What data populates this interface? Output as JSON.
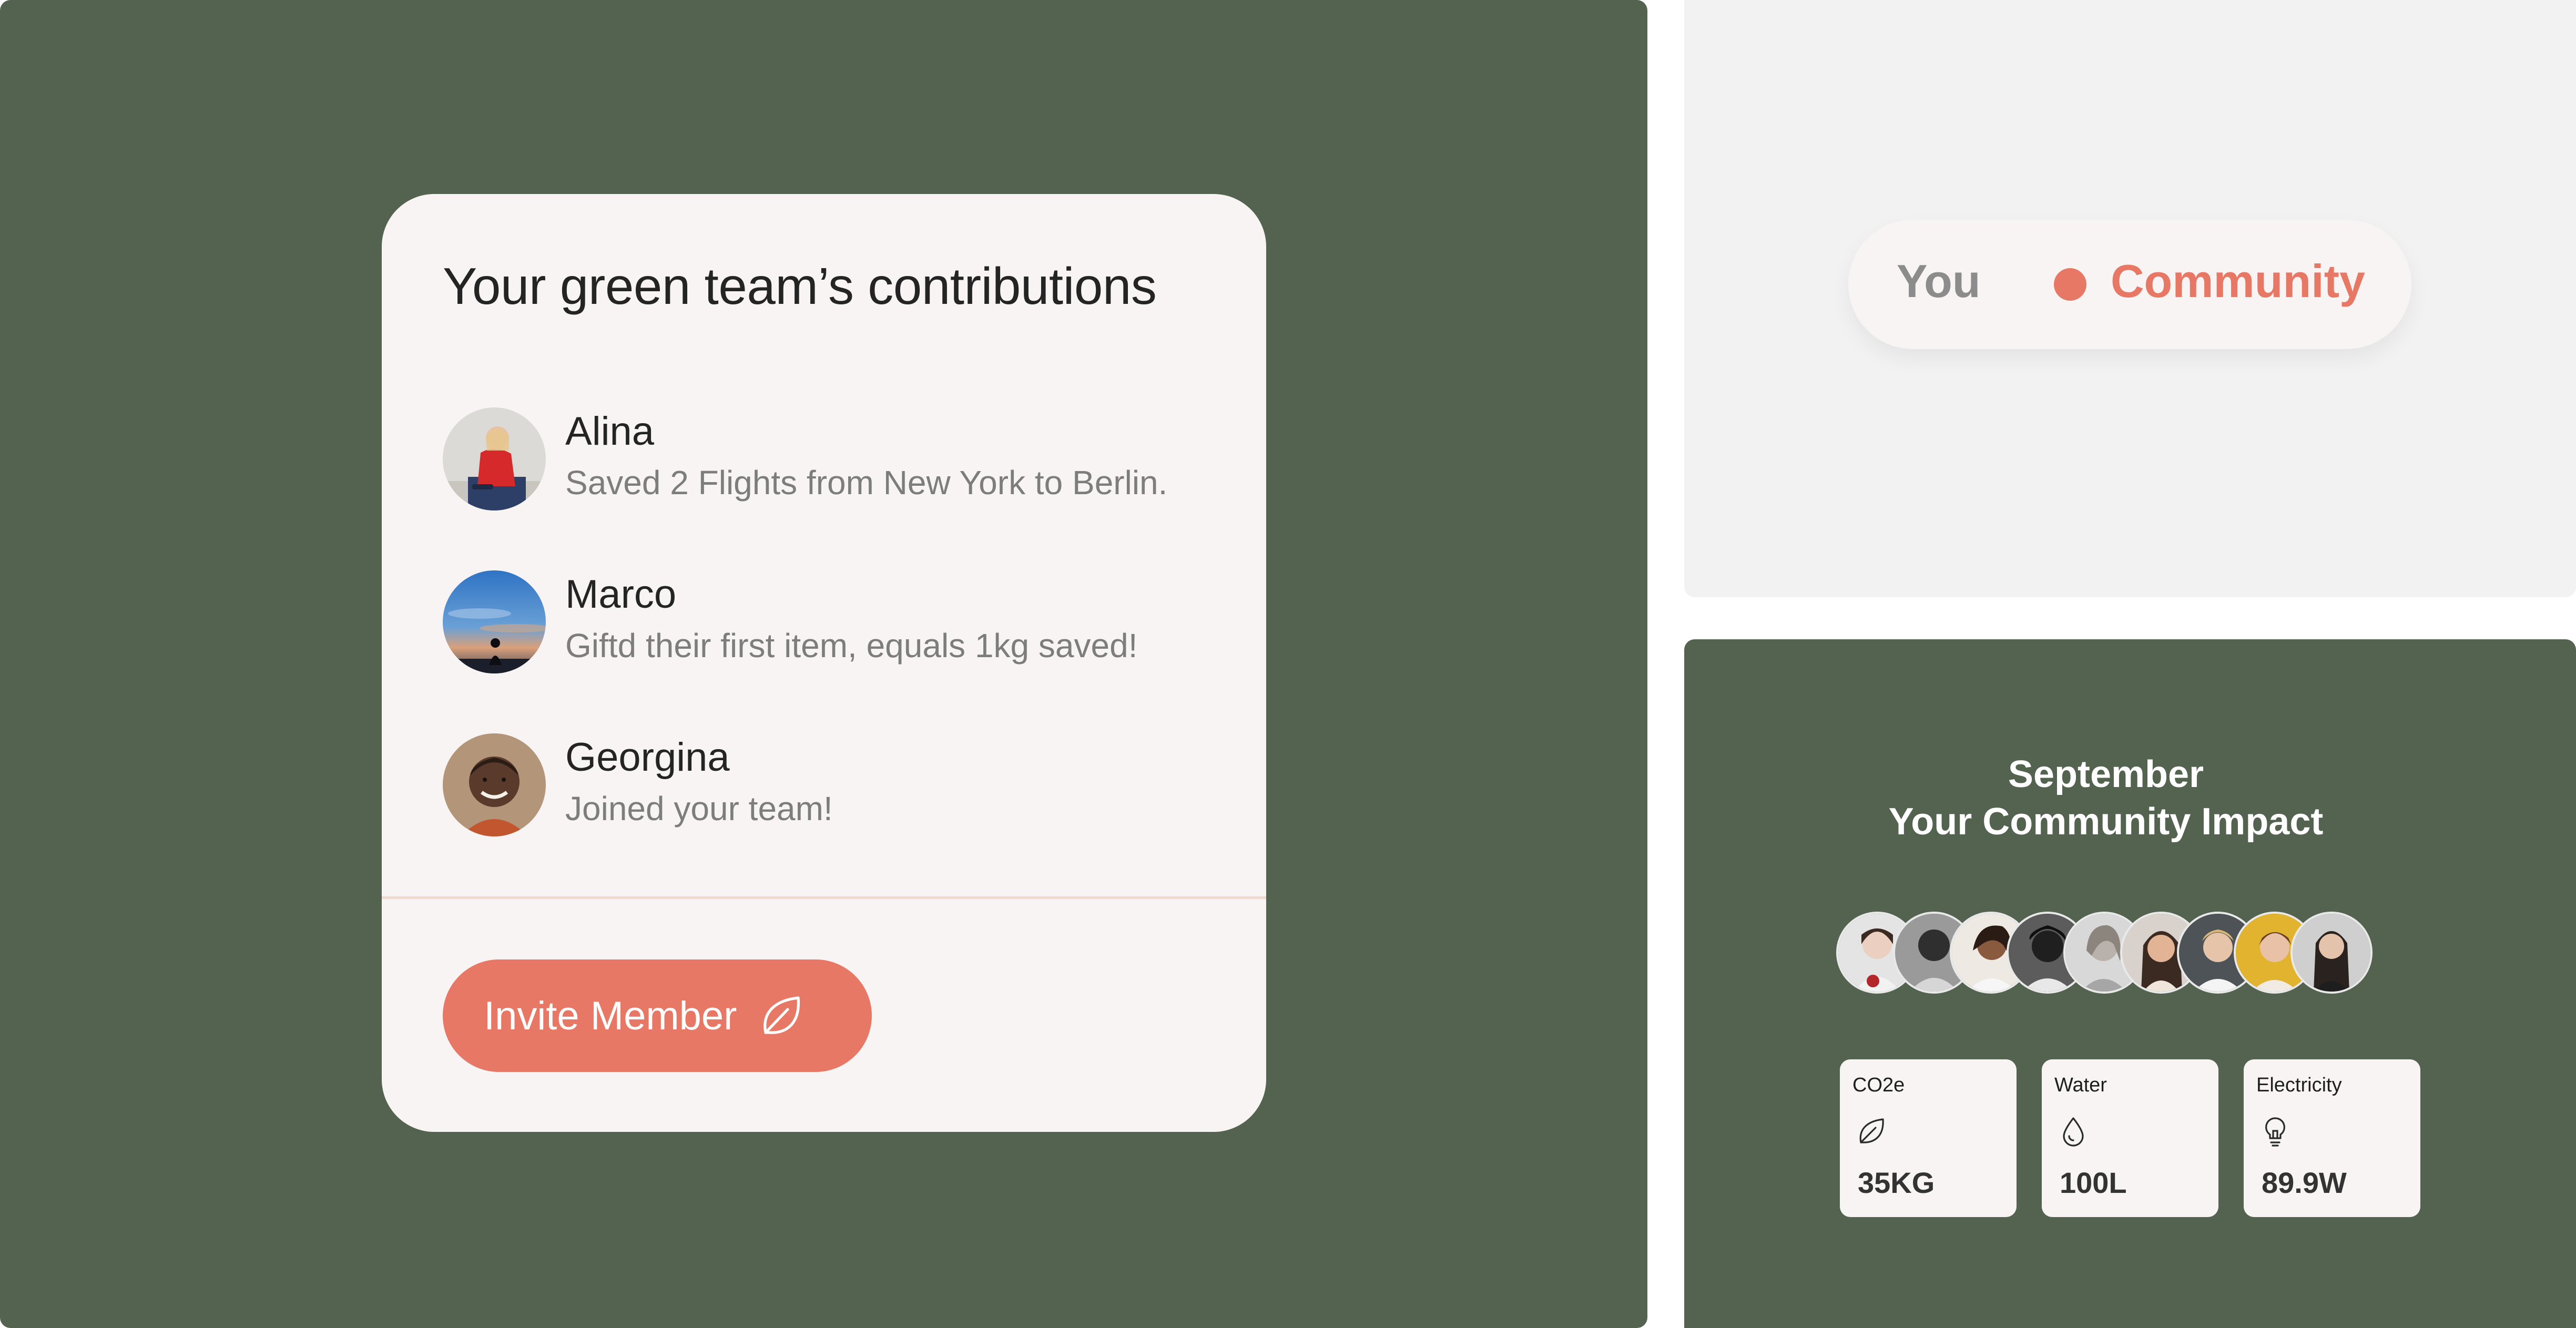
{
  "contributions": {
    "title": "Your green team’s contributions",
    "members": [
      {
        "name": "Alina",
        "description": "Saved 2 Flights from New York to Berlin."
      },
      {
        "name": "Marco",
        "description": "Giftd their first item, equals 1kg saved!"
      },
      {
        "name": "Georgina",
        "description": "Joined your team!"
      }
    ],
    "invite_button": {
      "label": "Invite Member",
      "icon": "leaf-icon"
    }
  },
  "toggle": {
    "options": [
      "You",
      "Community"
    ],
    "selected": "Community"
  },
  "impact": {
    "month": "September",
    "title": "Your Community Impact",
    "avatar_count": 9,
    "stats": [
      {
        "label": "CO2e",
        "icon": "leaf-icon",
        "value": "35KG"
      },
      {
        "label": "Water",
        "icon": "water-drop-icon",
        "value": "100L"
      },
      {
        "label": "Electricity",
        "icon": "lightbulb-icon",
        "value": "89.9W"
      }
    ]
  },
  "colors": {
    "panel_green": "#536350",
    "card_background": "#f8f4f3",
    "accent_coral": "#e87866",
    "light_panel": "#f2f2f2"
  }
}
